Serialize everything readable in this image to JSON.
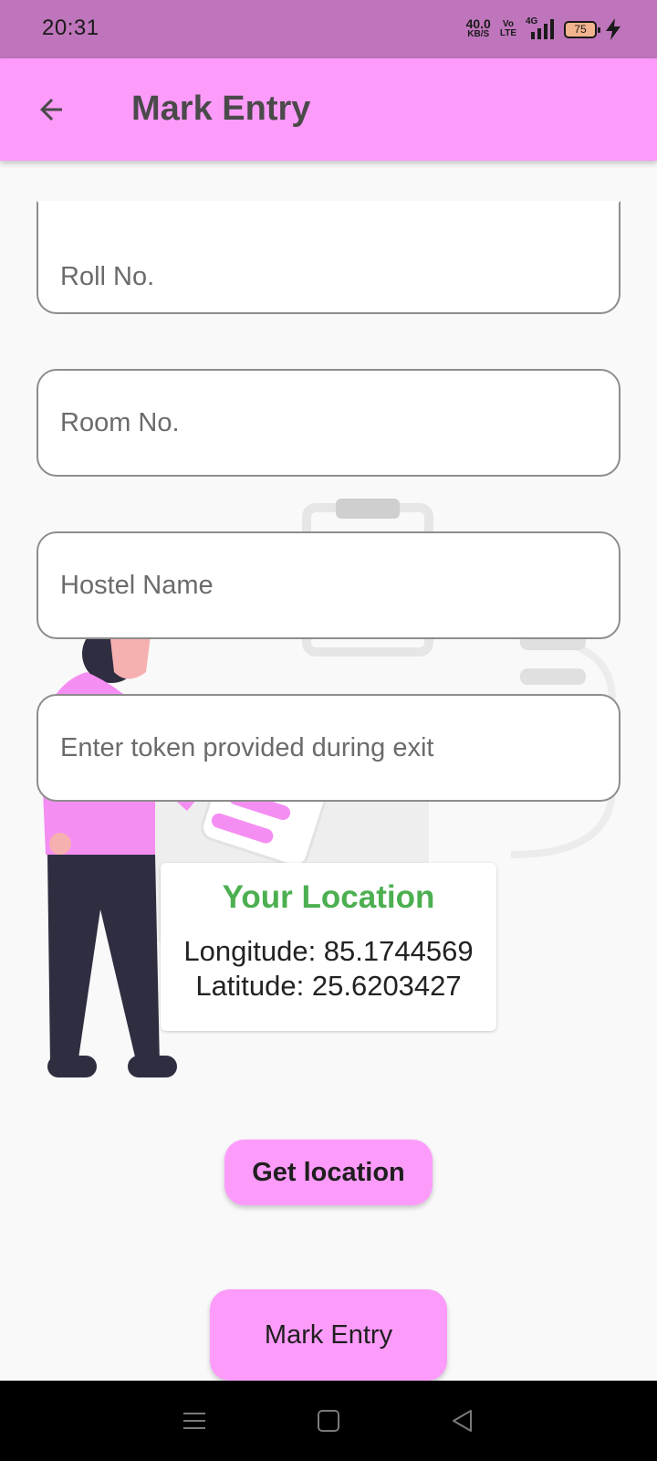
{
  "status_bar": {
    "time": "20:31",
    "net_speed_value": "40.0",
    "net_speed_unit": "KB/S",
    "volte_top": "Vo",
    "volte_bottom": "LTE",
    "network": "4G",
    "battery": "75"
  },
  "app_bar": {
    "title": "Mark Entry",
    "back_icon": "arrow-left-icon"
  },
  "form": {
    "roll_placeholder": "Roll No.",
    "room_placeholder": "Room No.",
    "hostel_placeholder": "Hostel Name",
    "token_placeholder": "Enter token provided during exit"
  },
  "location": {
    "title": "Your Location",
    "longitude_text": "Longitude: 85.1744569",
    "latitude_text": "Latitude: 25.6203427"
  },
  "buttons": {
    "get_location": "Get location",
    "mark_entry": "Mark Entry"
  },
  "nav_bar": {
    "icons": [
      "menu-icon",
      "home-square-icon",
      "back-triangle-icon"
    ]
  },
  "colors": {
    "status_bar": "#bf75bb",
    "app_bar": "#fd9bfb",
    "accent_green": "#4caf50",
    "background": "#f9f9f9"
  }
}
